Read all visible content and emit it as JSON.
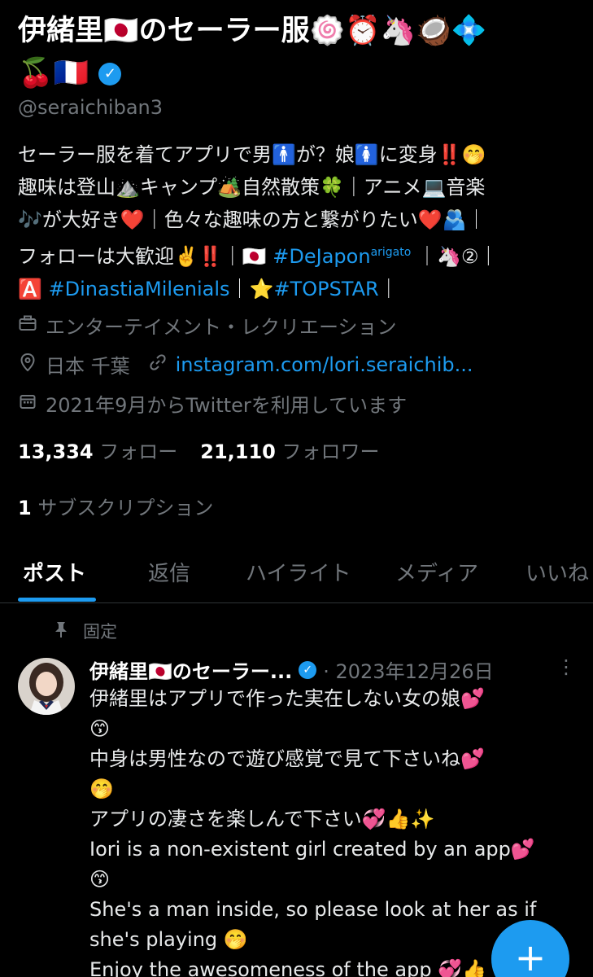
{
  "profile": {
    "name_line1": "伊緒里🇯🇵のセーラー服🍥⏰🦄🥥💠",
    "name_line2": "🍒🇫🇷",
    "verified_icon": "✓",
    "handle": "@seraichiban3",
    "bio_l1": "セーラー服を着てアプリで男🚹が？娘🚺に変身‼️🤭",
    "bio_l2": "趣味は登山⛰️キャンプ🏕️自然散策🍀｜アニメ💻音楽",
    "bio_l3": "🎶が大好き❤️｜色々な趣味の方と繋がりたい❤️🫂｜",
    "bio_l4a": "フォローは大歓迎✌️‼️｜🇯🇵 ",
    "bio_l4_tag": "#DeJapon",
    "bio_l4_sup": "arigato",
    "bio_l4b": " ｜🦄②｜",
    "bio_l5a": "🅰️ ",
    "bio_l5_tag1": "#DinastiaMilenials",
    "bio_l5_mid": "｜⭐",
    "bio_l5_tag2": "#TOPSTAR",
    "bio_l5_end": "｜",
    "category": "エンターテイメント・レクリエーション",
    "location": "日本 千葉",
    "website": "instagram.com/lori.seraichib...",
    "joined": "2021年9月からTwitterを利用しています",
    "following_count": "13,334",
    "following_label": "フォロー",
    "followers_count": "21,110",
    "followers_label": "フォロワー",
    "subs_count": "1",
    "subs_label": "サブスクリプション"
  },
  "tabs": [
    "ポスト",
    "返信",
    "ハイライト",
    "メディア",
    "いいね"
  ],
  "pinned_label": "固定",
  "post": {
    "author": "伊緒里🇯🇵のセーラー...",
    "date": "· 2023年12月26日",
    "more": "⋮",
    "lines": [
      "伊緒里はアプリで作った実在しない女の娘💕",
      "😙",
      "中身は男性なので遊び感覚で見て下さいね💕",
      "🤭",
      "アプリの凄さを楽しんで下さい💞👍✨",
      "Iori is a non-existent girl created by an app💕",
      "😙",
      "She's a man inside, so please look at her as if",
      "she's playing 🤭",
      "Enjoy the awesomeness of the app 💞👍"
    ]
  },
  "fab_label": "+",
  "icons": {
    "category": "briefcase-icon",
    "location": "location-pin-icon",
    "link": "link-icon",
    "calendar": "calendar-icon",
    "pin": "pin-icon"
  },
  "colors": {
    "accent": "#1d9bf0",
    "muted": "#71767b",
    "background": "#000000"
  }
}
